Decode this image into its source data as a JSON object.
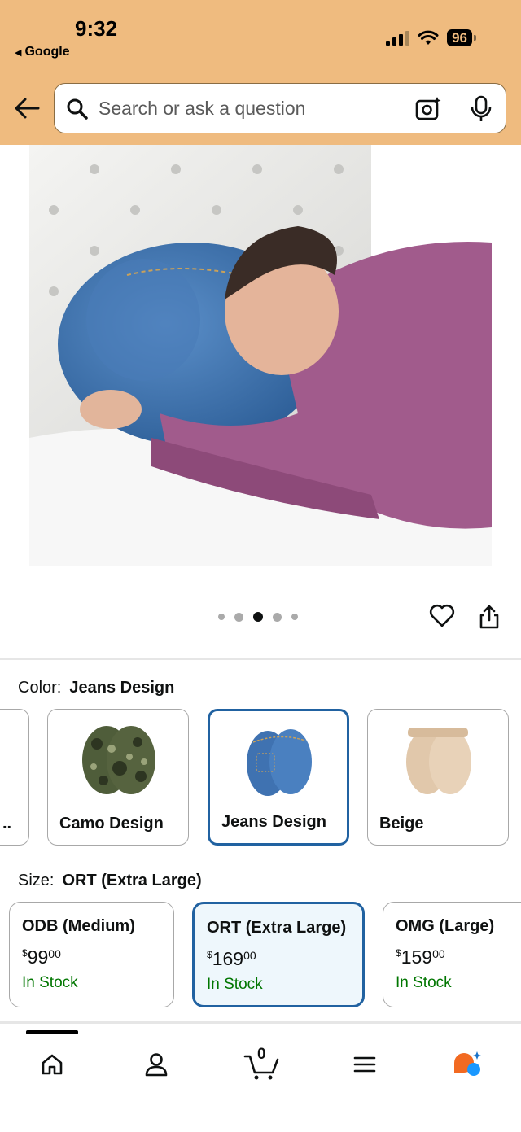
{
  "status_bar": {
    "time": "9:32",
    "back_app": "Google",
    "battery": "96"
  },
  "search": {
    "placeholder": "Search or ask a question"
  },
  "icons": {
    "back": "back-arrow-icon",
    "search": "search-icon",
    "camera": "camera-icon",
    "mic": "microphone-icon",
    "favorite": "heart-icon",
    "share": "share-icon"
  },
  "image_pager": {
    "count": 5,
    "active_index": 2
  },
  "color": {
    "label": "Color:",
    "selected": "Jeans Design",
    "options": [
      {
        "label": "..",
        "selected": false
      },
      {
        "label": "Camo Design",
        "selected": false
      },
      {
        "label": "Jeans Design",
        "selected": true
      },
      {
        "label": "Beige",
        "selected": false
      }
    ]
  },
  "size": {
    "label": "Size:",
    "selected": "ORT (Extra Large)",
    "options": [
      {
        "name": "ODB (Medium)",
        "price_dollars": "99",
        "price_cents": "00",
        "currency": "$",
        "stock": "In Stock",
        "selected": false
      },
      {
        "name": "ORT (Extra Large)",
        "price_dollars": "169",
        "price_cents": "00",
        "currency": "$",
        "stock": "In Stock",
        "selected": true
      },
      {
        "name": "OMG (Large)",
        "price_dollars": "159",
        "price_cents": "00",
        "currency": "$",
        "stock": "In Stock",
        "selected": false
      }
    ]
  },
  "tabbar": {
    "cart_count": "0",
    "tabs": [
      "home-icon",
      "account-icon",
      "cart-icon",
      "menu-icon",
      "rufus-icon"
    ]
  },
  "colors": {
    "header_bg": "#efbb7f",
    "selected_border": "#2162a1",
    "in_stock": "#007600",
    "selected_bg": "#eef7fc"
  }
}
